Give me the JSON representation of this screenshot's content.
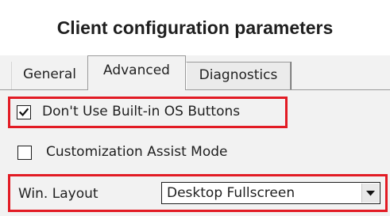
{
  "title": "Client configuration parameters",
  "tabs": [
    {
      "label": "General",
      "selected": false
    },
    {
      "label": "Advanced",
      "selected": true
    },
    {
      "label": "Diagnostics",
      "selected": false
    }
  ],
  "options": {
    "builtin_buttons": {
      "label": "Don't Use Built-in OS Buttons",
      "checked": true
    },
    "customization_assist": {
      "label": "Customization Assist Mode",
      "checked": false
    }
  },
  "win_layout": {
    "label": "Win. Layout",
    "selected": "Desktop Fullscreen"
  },
  "icons": {
    "checkmark": "check-icon",
    "dropdown": "chevron-down-icon"
  },
  "colors": {
    "highlight": "#e21b24",
    "panel_bg": "#f2f2f2"
  }
}
